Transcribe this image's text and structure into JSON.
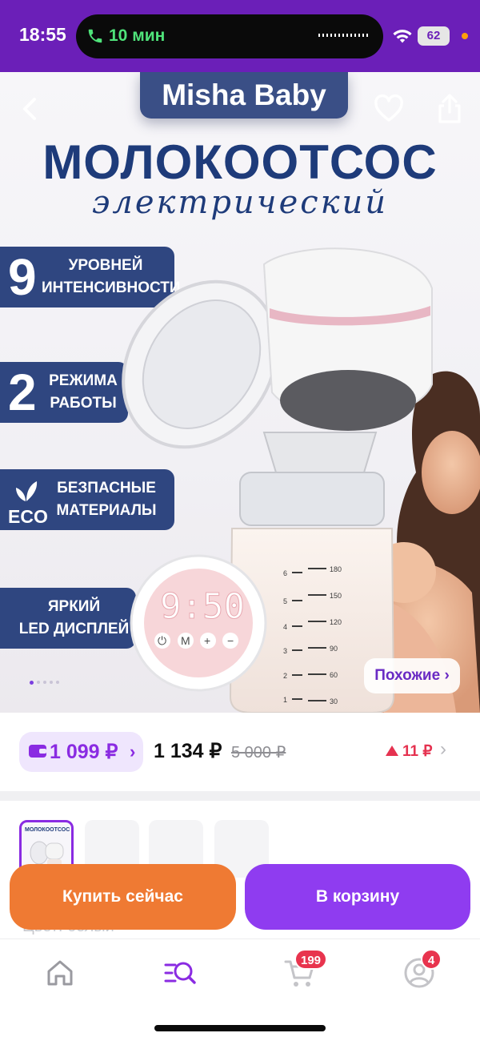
{
  "status_bar": {
    "time": "18:55",
    "call_duration": "10 мин",
    "battery": "62"
  },
  "hero": {
    "brand": "Misha Baby",
    "headline": "МОЛОКООТСОС",
    "subline": "электрический",
    "features": [
      {
        "number": "9",
        "label": "УРОВНЕЙ\nИНТЕНСИВНОСТИ"
      },
      {
        "number": "2",
        "label": "РЕЖИМА\nРАБОТЫ"
      },
      {
        "mark": "ECO",
        "label": "БЕЗПАСНЫЕ\nМАТЕРИАЛЫ"
      },
      {
        "label": "ЯРКИЙ\nLED ДИСПЛЕЙ"
      }
    ],
    "display_readout": "9:50",
    "display_buttons": [
      "⏻",
      "M",
      "+",
      "−"
    ],
    "bottle_ml": [
      "180",
      "150",
      "120",
      "90",
      "60",
      "30"
    ],
    "bottle_oz": [
      "6",
      "5",
      "4",
      "3",
      "2",
      "1"
    ],
    "similar_label": "Похожие ›",
    "icons": {
      "back": "back-chevron-icon",
      "favorite": "heart-icon",
      "share": "share-icon"
    }
  },
  "price": {
    "wallet_price": "1 099 ₽",
    "wallet_chevron": "›",
    "price": "1 134 ₽",
    "old_price": "5 000 ₽",
    "delta": "11 ₽",
    "accent": "#8a2be2",
    "delta_color": "#e53250"
  },
  "gallery": {
    "thumb_title": "МОЛОКООТСОС",
    "ghost_text": "Цвет: белый"
  },
  "actions": {
    "buy_now": "Купить сейчас",
    "add_to_cart": "В корзину",
    "buy_color": "#ef7a33",
    "cart_color": "#8f3cf0"
  },
  "tabbar": {
    "items": [
      {
        "name": "home",
        "icon": "home-icon"
      },
      {
        "name": "catalog",
        "icon": "catalog-search-icon",
        "active": true
      },
      {
        "name": "cart",
        "icon": "cart-icon",
        "badge": "199"
      },
      {
        "name": "profile",
        "icon": "profile-icon",
        "badge": "4"
      }
    ]
  }
}
